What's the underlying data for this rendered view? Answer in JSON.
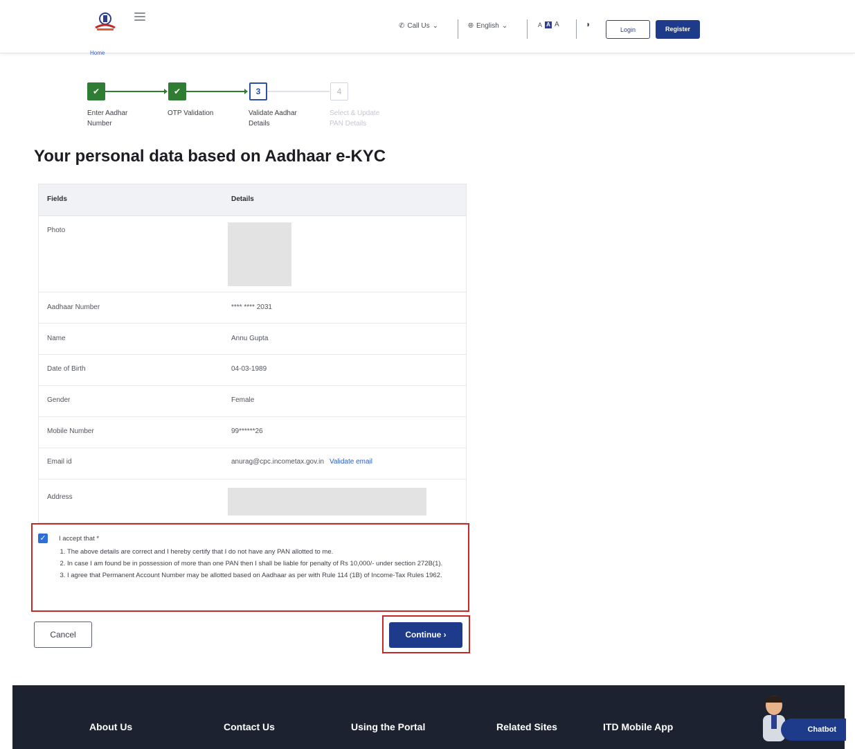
{
  "header": {
    "call_us": "Call Us",
    "language": "English",
    "font_small": "A",
    "font_normal": "A",
    "font_large": "A",
    "login": "Login",
    "register": "Register"
  },
  "breadcrumb": "Home",
  "stepper": [
    {
      "number": "",
      "label_line1": "Enter Aadhar",
      "label_line2": "Number",
      "state": "done"
    },
    {
      "number": "",
      "label_line1": "OTP Validation",
      "label_line2": "",
      "state": "done"
    },
    {
      "number": "3",
      "label_line1": "Validate Aadhar",
      "label_line2": "Details",
      "state": "current"
    },
    {
      "number": "4",
      "label_line1": "Select & Update",
      "label_line2": "PAN Details",
      "state": "pending"
    }
  ],
  "page_title": "Your personal data based on Aadhaar e-KYC",
  "table": {
    "headers": [
      "Fields",
      "Details"
    ],
    "rows": [
      {
        "field": "Photo",
        "value": ""
      },
      {
        "field": "Aadhaar Number",
        "value": "**** **** 2031"
      },
      {
        "field": "Name",
        "value": "Annu Gupta"
      },
      {
        "field": "Date of Birth",
        "value": "04-03-1989"
      },
      {
        "field": "Gender",
        "value": "Female"
      },
      {
        "field": "Mobile Number",
        "value": "99******26"
      },
      {
        "field": "Email id",
        "value": "anurag@cpc.incometax.gov.in",
        "link": "Validate email"
      },
      {
        "field": "Address",
        "value": ""
      }
    ]
  },
  "declaration": {
    "checked": true,
    "heading": "I accept that *",
    "items": [
      "The above details are correct and I hereby certify that I do not have any PAN allotted to me.",
      "In case I am found be in possession of more than one PAN then I shall be liable for penalty of Rs 10,000/- under section 272B(1).",
      "I agree that Permanent Account Number may be allotted based on Aadhaar as per with Rule 114 (1B) of Income-Tax Rules 1962."
    ]
  },
  "actions": {
    "cancel": "Cancel",
    "continue": "Continue"
  },
  "footer": {
    "links": [
      "About Us",
      "Contact Us",
      "Using the Portal",
      "Related Sites",
      "ITD Mobile App"
    ],
    "chatbot": "Chatbot"
  },
  "colors": {
    "primary": "#1e3a8a",
    "success": "#2e7d32",
    "highlight": "#c62828",
    "footer_bg": "#1d2230"
  }
}
